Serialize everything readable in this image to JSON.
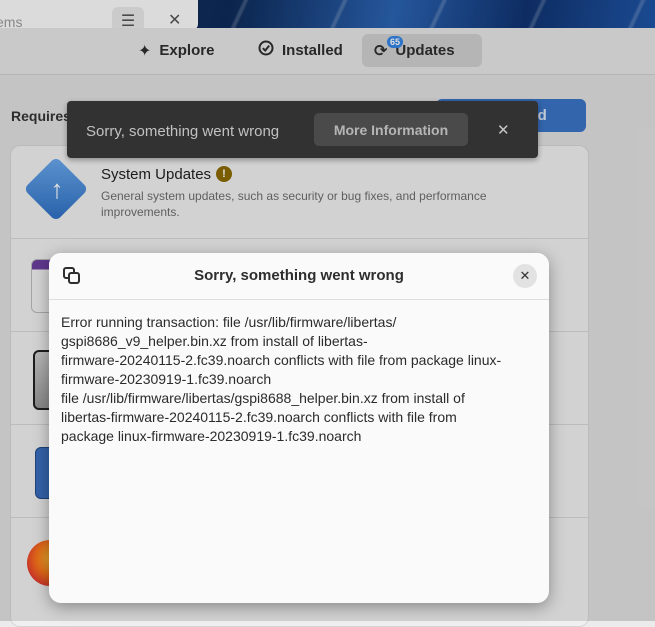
{
  "background_window": {
    "title": "ems",
    "menu_icon": "hamburger-icon",
    "close_icon": "close-icon"
  },
  "header": {
    "tabs": [
      {
        "label": "Explore",
        "icon": "sparkle-icon"
      },
      {
        "label": "Installed",
        "icon": "check-circle-icon"
      },
      {
        "label": "Updates",
        "icon": "refresh-icon",
        "badge": "65",
        "active": true
      }
    ]
  },
  "updates": {
    "section_label": "Requires Restart",
    "download_label": "Download",
    "system_updates": {
      "title": "System Updates",
      "description": "General system updates, such as security or bug fixes, and performance improvements.",
      "warning_icon": "warning-icon"
    }
  },
  "toast": {
    "message": "Sorry, something went wrong",
    "button_label": "More Information",
    "close_icon": "close-icon"
  },
  "dialog": {
    "title": "Sorry, something went wrong",
    "copy_icon": "copy-icon",
    "close_icon": "close-icon",
    "body": "Error running transaction: file /usr/lib/firmware/libertas/\ngspi8686_v9_helper.bin.xz from install of libertas-\nfirmware-20240115-2.fc39.noarch conflicts with file from package linux-\nfirmware-20230919-1.fc39.noarch\nfile /usr/lib/firmware/libertas/gspi8688_helper.bin.xz from install of\nlibertas-firmware-20240115-2.fc39.noarch conflicts with file from\npackage linux-firmware-20230919-1.fc39.noarch"
  },
  "colors": {
    "accent": "#3584e4",
    "toast_bg": "#3a3a3a",
    "warning": "#8a6a00"
  }
}
